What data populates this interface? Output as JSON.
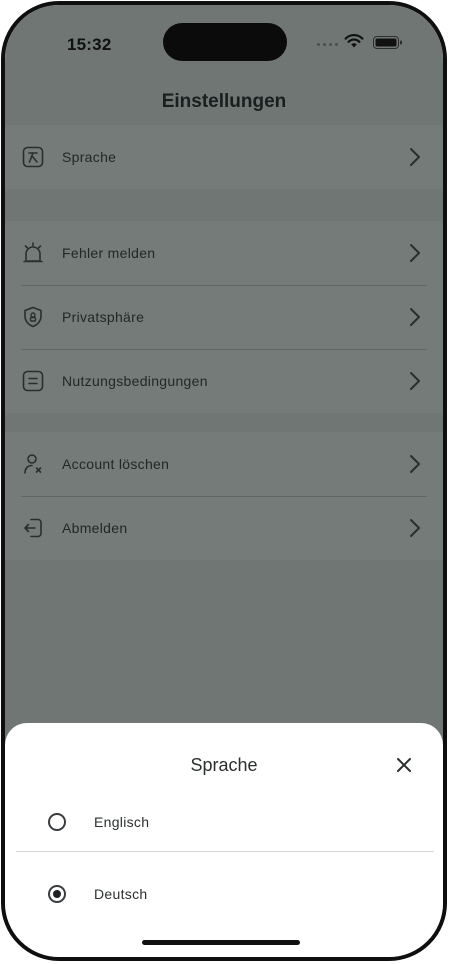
{
  "status": {
    "time": "15:32"
  },
  "header": {
    "title": "Einstellungen"
  },
  "groups": {
    "language": [
      {
        "label": "Sprache",
        "icon": "translate-icon"
      }
    ],
    "support": [
      {
        "label": "Fehler melden",
        "icon": "alarm-light-icon"
      },
      {
        "label": "Privatsphäre",
        "icon": "privacy-shield-icon"
      },
      {
        "label": "Nutzungsbedingungen",
        "icon": "terms-document-icon"
      }
    ],
    "account": [
      {
        "label": "Account löschen",
        "icon": "delete-user-icon"
      },
      {
        "label": "Abmelden",
        "icon": "logout-icon"
      }
    ]
  },
  "sheet": {
    "title": "Sprache",
    "options": [
      {
        "label": "Englisch",
        "selected": false
      },
      {
        "label": "Deutsch",
        "selected": true
      }
    ]
  },
  "colors": {
    "overlay": "#6f7674",
    "sheet": "#ffffff"
  }
}
